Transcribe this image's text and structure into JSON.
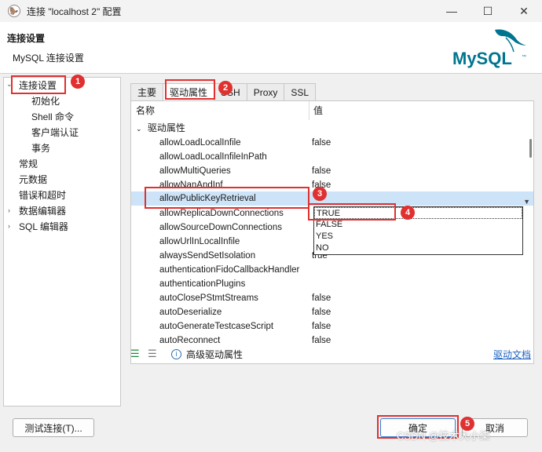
{
  "window": {
    "title": "连接 \"localhost 2\" 配置",
    "minimize": "—",
    "maximize": "☐",
    "close": "✕",
    "app_icon": "dbeaver-icon"
  },
  "header": {
    "title": "连接设置",
    "subtitle": "MySQL 连接设置",
    "logo_text": "MySQL",
    "logo_tm": "™"
  },
  "sidebar": {
    "items": [
      {
        "label": "连接设置"
      },
      {
        "label": "初始化"
      },
      {
        "label": "Shell 命令"
      },
      {
        "label": "客户端认证"
      },
      {
        "label": "事务"
      },
      {
        "label": "常规"
      },
      {
        "label": "元数据"
      },
      {
        "label": "错误和超时"
      },
      {
        "label": "数据编辑器"
      },
      {
        "label": "SQL 编辑器"
      }
    ]
  },
  "tabs": [
    {
      "label": "主要"
    },
    {
      "label": "驱动属性"
    },
    {
      "label": "SSH"
    },
    {
      "label": "Proxy"
    },
    {
      "label": "SSL"
    }
  ],
  "grid": {
    "col_name": "名称",
    "col_value": "值",
    "group_label": "驱动属性",
    "rows": [
      {
        "name": "allowLoadLocalInfile",
        "value": "false"
      },
      {
        "name": "allowLoadLocalInfileInPath",
        "value": ""
      },
      {
        "name": "allowMultiQueries",
        "value": "false"
      },
      {
        "name": "allowNanAndInf",
        "value": "false"
      },
      {
        "name": "allowPublicKeyRetrieval",
        "value": ""
      },
      {
        "name": "allowReplicaDownConnections",
        "value": ""
      },
      {
        "name": "allowSourceDownConnections",
        "value": ""
      },
      {
        "name": "allowUrlInLocalInfile",
        "value": ""
      },
      {
        "name": "alwaysSendSetIsolation",
        "value": "true"
      },
      {
        "name": "authenticationFidoCallbackHandler",
        "value": ""
      },
      {
        "name": "authenticationPlugins",
        "value": ""
      },
      {
        "name": "autoClosePStmtStreams",
        "value": "false"
      },
      {
        "name": "autoDeserialize",
        "value": "false"
      },
      {
        "name": "autoGenerateTestcaseScript",
        "value": "false"
      },
      {
        "name": "autoReconnect",
        "value": "false"
      }
    ],
    "dropdown_options": [
      "TRUE",
      "FALSE",
      "YES",
      "NO"
    ]
  },
  "bottombar": {
    "advanced_label": "高级驱动属性",
    "doc_link": "驱动文档"
  },
  "buttons": {
    "test": "测试连接(T)...",
    "ok": "确定",
    "cancel": "取消"
  },
  "annotations": [
    "1",
    "2",
    "3",
    "4",
    "5"
  ],
  "watermark": "CSDN @技术大小柒",
  "colors": {
    "annotation_red": "#e03030",
    "selection_blue": "#cde3f7",
    "link_blue": "#1f63c0",
    "mysql_blue": "#00758f",
    "mysql_orange": "#f29111"
  }
}
